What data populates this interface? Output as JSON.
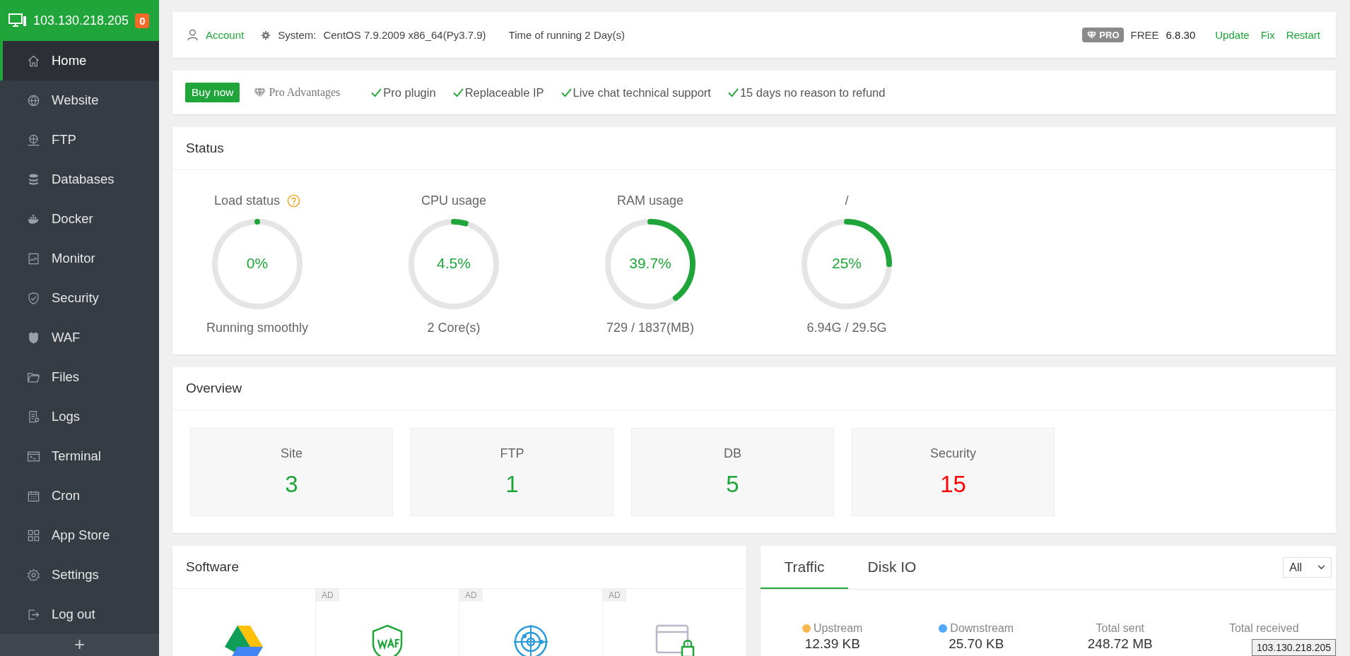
{
  "server": {
    "ip": "103.130.218.205",
    "notifications": "0"
  },
  "sidebar": {
    "items": [
      {
        "label": "Home",
        "kind": "home",
        "selected": true
      },
      {
        "label": "Website",
        "kind": "globe",
        "selected": false
      },
      {
        "label": "FTP",
        "kind": "ftp",
        "selected": false
      },
      {
        "label": "Databases",
        "kind": "database",
        "selected": false
      },
      {
        "label": "Docker",
        "kind": "whale",
        "selected": false
      },
      {
        "label": "Monitor",
        "kind": "monitor",
        "selected": false
      },
      {
        "label": "Security",
        "kind": "shield",
        "selected": false
      },
      {
        "label": "WAF",
        "kind": "waf",
        "selected": false
      },
      {
        "label": "Files",
        "kind": "folder",
        "selected": false
      },
      {
        "label": "Logs",
        "kind": "logs",
        "selected": false
      },
      {
        "label": "Terminal",
        "kind": "terminal",
        "selected": false
      },
      {
        "label": "Cron",
        "kind": "calendar",
        "selected": false
      },
      {
        "label": "App Store",
        "kind": "grid",
        "selected": false
      },
      {
        "label": "Settings",
        "kind": "gear",
        "selected": false
      },
      {
        "label": "Log out",
        "kind": "logout",
        "selected": false
      }
    ],
    "add_button": "+"
  },
  "topbar": {
    "account": "Account",
    "system_label": "System:",
    "system": "CentOS 7.9.2009 x86_64(Py3.7.9)",
    "uptime": "Time of running 2 Day(s)",
    "pro_badge": "PRO",
    "edition": "FREE",
    "version": "6.8.30",
    "links": [
      "Update",
      "Fix",
      "Restart"
    ]
  },
  "promo": {
    "buy": "Buy now",
    "advantages": "Pro Advantages",
    "features": [
      "Pro plugin",
      "Replaceable IP",
      "Live chat technical support",
      "15 days no reason to refund"
    ]
  },
  "status": {
    "title": "Status",
    "gauges": [
      {
        "label": "Load status",
        "help": true,
        "value": "0%",
        "level": 0,
        "detail": "Running smoothly"
      },
      {
        "label": "CPU usage",
        "help": false,
        "value": "4.5%",
        "level": 0.045,
        "detail": "2 Core(s)"
      },
      {
        "label": "RAM usage",
        "help": false,
        "value": "39.7%",
        "level": 0.397,
        "detail": "729 / 1837(MB)"
      },
      {
        "label": "/",
        "help": false,
        "value": "25%",
        "level": 0.25,
        "detail": "6.94G / 29.5G"
      }
    ]
  },
  "overview": {
    "title": "Overview",
    "cards": [
      {
        "label": "Site",
        "value": "3",
        "color": "#20a53a"
      },
      {
        "label": "FTP",
        "value": "1",
        "color": "#20a53a"
      },
      {
        "label": "DB",
        "value": "5",
        "color": "#20a53a"
      },
      {
        "label": "Security",
        "value": "15",
        "color": "#ff0000"
      }
    ]
  },
  "software": {
    "title": "Software",
    "items": [
      {
        "kind": "drive"
      },
      {
        "kind": "waf",
        "tag": "AD"
      },
      {
        "kind": "radar",
        "tag": "AD"
      },
      {
        "kind": "browser-lock",
        "tag": "AD"
      }
    ]
  },
  "traffic": {
    "tabs": [
      {
        "label": "Traffic",
        "selected": true
      },
      {
        "label": "Disk IO",
        "selected": false
      }
    ],
    "filter": "All",
    "stats": [
      {
        "label": "Upstream",
        "color": "#f7b851",
        "value": "12.39 KB"
      },
      {
        "label": "Downstream",
        "color": "#52a9ff",
        "value": "25.70 KB"
      },
      {
        "label": "Total sent",
        "value": "248.72 MB"
      },
      {
        "label": "Total received"
      }
    ]
  },
  "tooltip": "103.130.218.205"
}
